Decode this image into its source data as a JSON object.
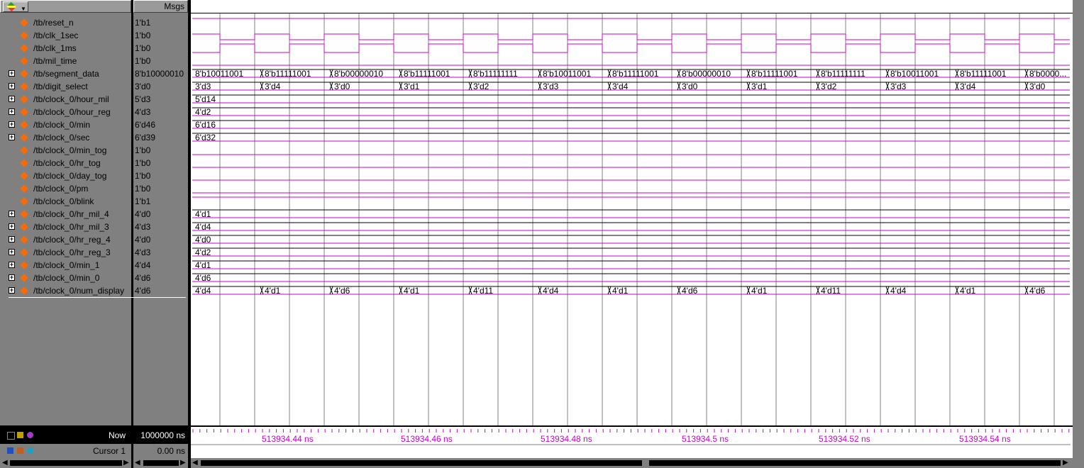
{
  "header": {
    "msgs_label": "Msgs",
    "tool_icon": "wave-tool-icon"
  },
  "signals": [
    {
      "name": "/tb/reset_n",
      "value": "1'b1",
      "bus": false
    },
    {
      "name": "/tb/clk_1sec",
      "value": "1'b0",
      "bus": false
    },
    {
      "name": "/tb/clk_1ms",
      "value": "1'b0",
      "bus": false
    },
    {
      "name": "/tb/mil_time",
      "value": "1'b0",
      "bus": false
    },
    {
      "name": "/tb/segment_data",
      "value": "8'b10000010",
      "bus": true
    },
    {
      "name": "/tb/digit_select",
      "value": "3'd0",
      "bus": true
    },
    {
      "name": "/tb/clock_0/hour_mil",
      "value": "5'd3",
      "bus": true
    },
    {
      "name": "/tb/clock_0/hour_reg",
      "value": "4'd3",
      "bus": true
    },
    {
      "name": "/tb/clock_0/min",
      "value": "6'd46",
      "bus": true
    },
    {
      "name": "/tb/clock_0/sec",
      "value": "6'd39",
      "bus": true
    },
    {
      "name": "/tb/clock_0/min_tog",
      "value": "1'b0",
      "bus": false
    },
    {
      "name": "/tb/clock_0/hr_tog",
      "value": "1'b0",
      "bus": false
    },
    {
      "name": "/tb/clock_0/day_tog",
      "value": "1'b0",
      "bus": false
    },
    {
      "name": "/tb/clock_0/pm",
      "value": "1'b0",
      "bus": false
    },
    {
      "name": "/tb/clock_0/blink",
      "value": "1'b1",
      "bus": false
    },
    {
      "name": "/tb/clock_0/hr_mil_4",
      "value": "4'd0",
      "bus": true
    },
    {
      "name": "/tb/clock_0/hr_mil_3",
      "value": "4'd3",
      "bus": true
    },
    {
      "name": "/tb/clock_0/hr_reg_4",
      "value": "4'd0",
      "bus": true
    },
    {
      "name": "/tb/clock_0/hr_reg_3",
      "value": "4'd3",
      "bus": true
    },
    {
      "name": "/tb/clock_0/min_1",
      "value": "4'd4",
      "bus": true
    },
    {
      "name": "/tb/clock_0/min_0",
      "value": "4'd6",
      "bus": true
    },
    {
      "name": "/tb/clock_0/num_display",
      "value": "4'd6",
      "bus": true
    }
  ],
  "waves": {
    "segment_data": [
      "8'b10011001",
      "8'b11111001",
      "8'b00000010",
      "8'b11111001",
      "8'b11111111",
      "8'b10011001",
      "8'b11111001",
      "8'b00000010",
      "8'b11111001",
      "8'b11111111",
      "8'b10011001",
      "8'b11111001",
      "8'b0000..."
    ],
    "digit_select": [
      "3'd3",
      "3'd4",
      "3'd0",
      "3'd1",
      "3'd2",
      "3'd3",
      "3'd4",
      "3'd0",
      "3'd1",
      "3'd2",
      "3'd3",
      "3'd4",
      "3'd0"
    ],
    "hour_mil": "5'd14",
    "hour_reg": "4'd2",
    "min": "6'd16",
    "sec": "6'd32",
    "hr_mil_4": "4'd1",
    "hr_mil_3": "4'd4",
    "hr_reg_4": "4'd0",
    "hr_reg_3": "4'd2",
    "min_1": "4'd1",
    "min_0": "4'd6",
    "num_display": [
      "4'd4",
      "4'd1",
      "4'd6",
      "4'd1",
      "4'd11",
      "4'd4",
      "4'd1",
      "4'd6",
      "4'd1",
      "4'd11",
      "4'd4",
      "4'd1",
      "4'd6"
    ]
  },
  "status": {
    "now_label": "Now",
    "now_value": "1000000 ns",
    "cursor_label": "Cursor 1",
    "cursor_value": "0.00 ns"
  },
  "timeline": {
    "labels": [
      "513934.44 ns",
      "513934.46 ns",
      "513934.48 ns",
      "513934.5 ns",
      "513934.52 ns",
      "513934.54 ns"
    ]
  },
  "colors": {
    "wave": "#cc00cc",
    "timeline_text": "#cc00cc",
    "grid": "#808080",
    "bus_text": "#000000"
  }
}
